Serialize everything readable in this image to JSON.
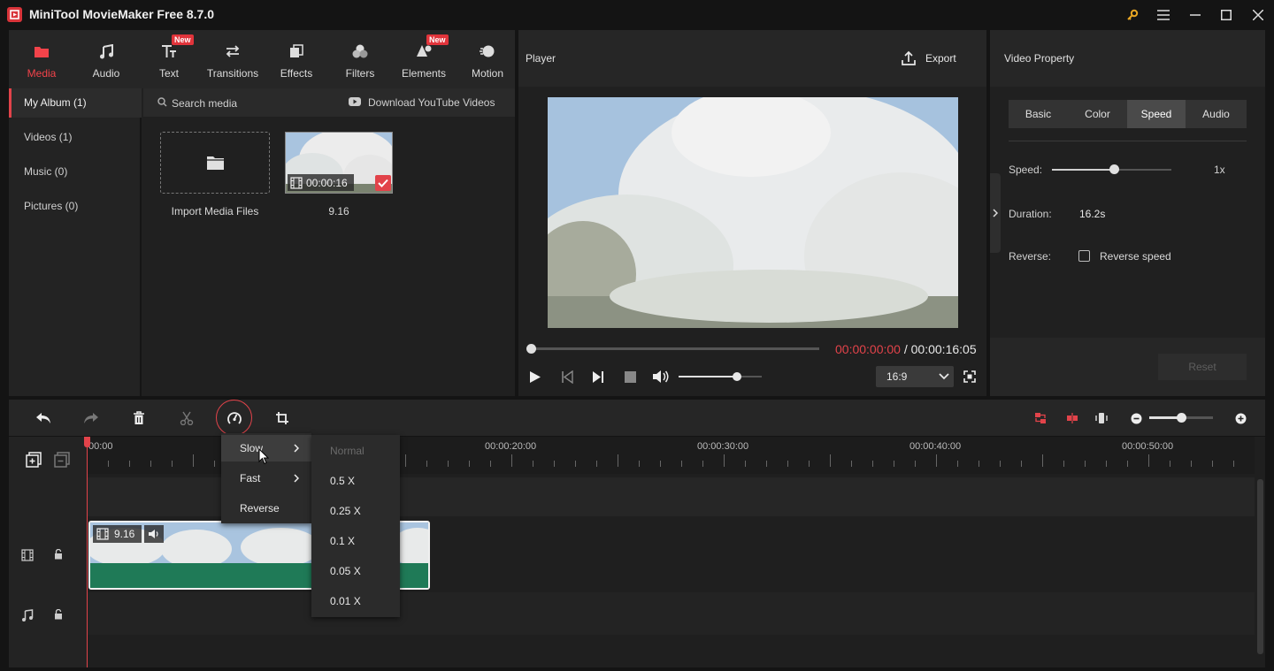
{
  "window": {
    "title": "MiniTool MovieMaker Free 8.7.0"
  },
  "tabs": [
    {
      "label": "Media",
      "icon": "media-folder-icon",
      "active": true
    },
    {
      "label": "Audio",
      "icon": "music-note-icon"
    },
    {
      "label": "Text",
      "icon": "text-icon",
      "badge": "New"
    },
    {
      "label": "Transitions",
      "icon": "transitions-icon"
    },
    {
      "label": "Effects",
      "icon": "effects-icon"
    },
    {
      "label": "Filters",
      "icon": "filters-icon"
    },
    {
      "label": "Elements",
      "icon": "elements-icon",
      "badge": "New"
    },
    {
      "label": "Motion",
      "icon": "motion-icon"
    }
  ],
  "sidebar": {
    "items": [
      {
        "label": "My Album (1)",
        "active": true
      },
      {
        "label": "Videos (1)"
      },
      {
        "label": "Music (0)"
      },
      {
        "label": "Pictures (0)"
      }
    ]
  },
  "media": {
    "search_placeholder": "Search media",
    "download_label": "Download YouTube Videos",
    "import_label": "Import Media Files",
    "clip": {
      "name": "9.16",
      "duration": "00:00:16"
    }
  },
  "player": {
    "title": "Player",
    "export_label": "Export",
    "current_time": "00:00:00:00",
    "separator": " / ",
    "total_time": "00:00:16:05",
    "aspect_ratio": "16:9",
    "progress": 0,
    "volume": 0.7
  },
  "property": {
    "title": "Video Property",
    "tabs": [
      "Basic",
      "Color",
      "Speed",
      "Audio"
    ],
    "active_tab": "Speed",
    "speed_label": "Speed:",
    "speed_value": "1x",
    "speed_slider": 0.52,
    "duration_label": "Duration:",
    "duration_value": "16.2s",
    "reverse_label": "Reverse:",
    "reverse_checkbox": "Reverse speed",
    "reset_label": "Reset"
  },
  "timeline": {
    "ruler": [
      "00:00",
      "00:00:20:00",
      "00:00:30:00",
      "00:00:40:00",
      "00:00:50:00"
    ],
    "clip_name": "9.16",
    "zoom": 0.5
  },
  "context_menu": {
    "items": [
      "Slow",
      "Fast",
      "Reverse"
    ],
    "active": "Slow",
    "submenu": [
      "Normal",
      "0.5 X",
      "0.25 X",
      "0.1 X",
      "0.05 X",
      "0.01 X"
    ],
    "disabled": "Normal"
  },
  "colors": {
    "accent": "#e2434a",
    "clip_audio": "#1f7a57",
    "time_current": "#e2434a"
  }
}
